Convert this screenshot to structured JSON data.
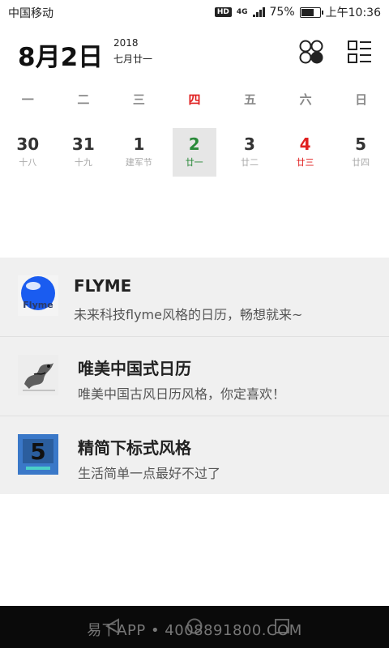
{
  "status_bar": {
    "carrier": "中国移动",
    "hd": "HD",
    "network": "4G",
    "battery_percent": "75%",
    "battery_level": 0.75,
    "time": "上午10:36"
  },
  "header": {
    "date": "8月2日",
    "year": "2018",
    "lunar": "七月廿一"
  },
  "weekdays": [
    "一",
    "二",
    "三",
    "四",
    "五",
    "六",
    "日"
  ],
  "days": [
    {
      "num": "30",
      "sub": "十八"
    },
    {
      "num": "31",
      "sub": "十九"
    },
    {
      "num": "1",
      "sub": "建军节"
    },
    {
      "num": "2",
      "sub": "廿一"
    },
    {
      "num": "3",
      "sub": "廿二"
    },
    {
      "num": "4",
      "sub": "廿三"
    },
    {
      "num": "5",
      "sub": "廿四"
    }
  ],
  "themes": [
    {
      "title": "FLYME",
      "desc": "未来科技flyme风格的日历，畅想就来~",
      "thumb_label": "Flyme"
    },
    {
      "title": "唯美中国式日历",
      "desc": "唯美中国古风日历风格，你定喜欢！"
    },
    {
      "title": "精简下标式风格",
      "desc": "生活简单一点最好不过了",
      "thumb_label": "5"
    }
  ],
  "navbar": {
    "watermark": "易下APP • 4008891800.COM"
  },
  "colors": {
    "selected_green": "#2a8a3a",
    "red": "#e02020",
    "selected_bg": "#e6e6e6",
    "list_bg": "#f0f0f0"
  }
}
